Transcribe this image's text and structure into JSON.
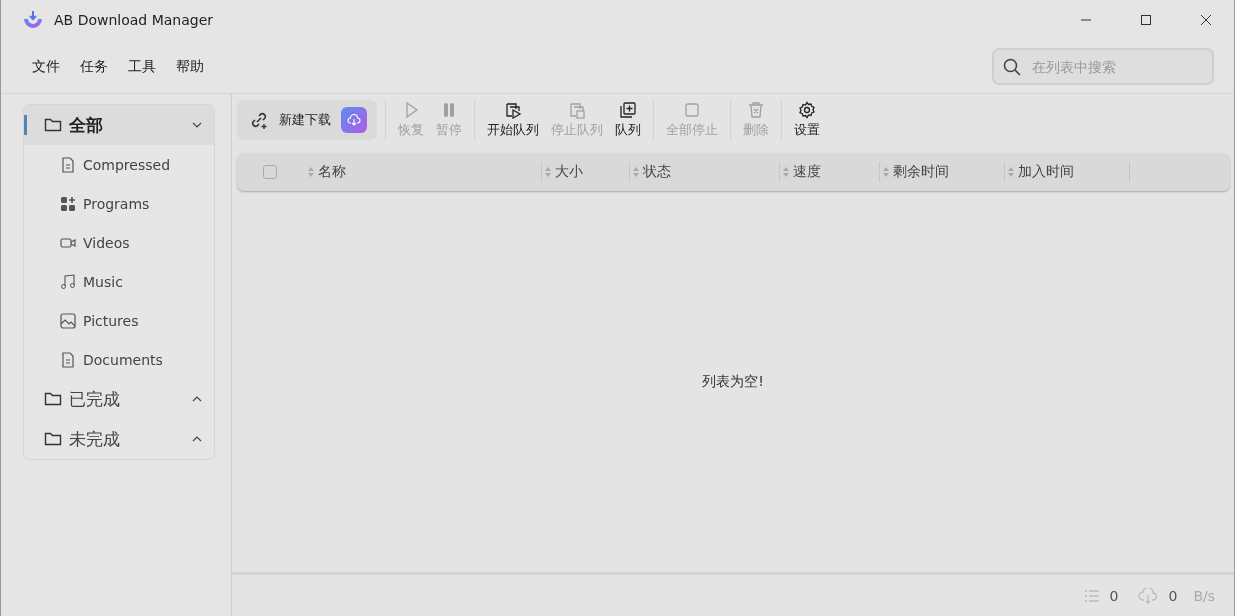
{
  "window": {
    "title": "AB Download Manager"
  },
  "menu": [
    "文件",
    "任务",
    "工具",
    "帮助"
  ],
  "search": {
    "placeholder": "在列表中搜索"
  },
  "sidebar": {
    "categories": [
      {
        "label": "全部",
        "selected": true,
        "expanded": true,
        "children": [
          {
            "label": "Compressed"
          },
          {
            "label": "Programs"
          },
          {
            "label": "Videos"
          },
          {
            "label": "Music"
          },
          {
            "label": "Pictures"
          },
          {
            "label": "Documents"
          }
        ]
      },
      {
        "label": "已完成",
        "selected": false,
        "expanded": false
      },
      {
        "label": "未完成",
        "selected": false,
        "expanded": false
      }
    ]
  },
  "new_download": {
    "label": "新建下载"
  },
  "toolbar": [
    {
      "label": "恢复",
      "disabled": true
    },
    {
      "label": "暂停",
      "disabled": true
    },
    {
      "label": "开始队列",
      "disabled": false
    },
    {
      "label": "停止队列",
      "disabled": true
    },
    {
      "label": "队列",
      "disabled": false
    },
    {
      "label": "全部停止",
      "disabled": true
    },
    {
      "label": "删除",
      "disabled": true
    },
    {
      "label": "设置",
      "disabled": false
    }
  ],
  "table": {
    "select_all_checked": false,
    "columns": [
      "名称",
      "大小",
      "状态",
      "速度",
      "剩余时间",
      "加入时间"
    ],
    "empty_message": "列表为空!"
  },
  "status_bar": {
    "count": "0",
    "speed": "0",
    "speed_unit": "B/s"
  }
}
